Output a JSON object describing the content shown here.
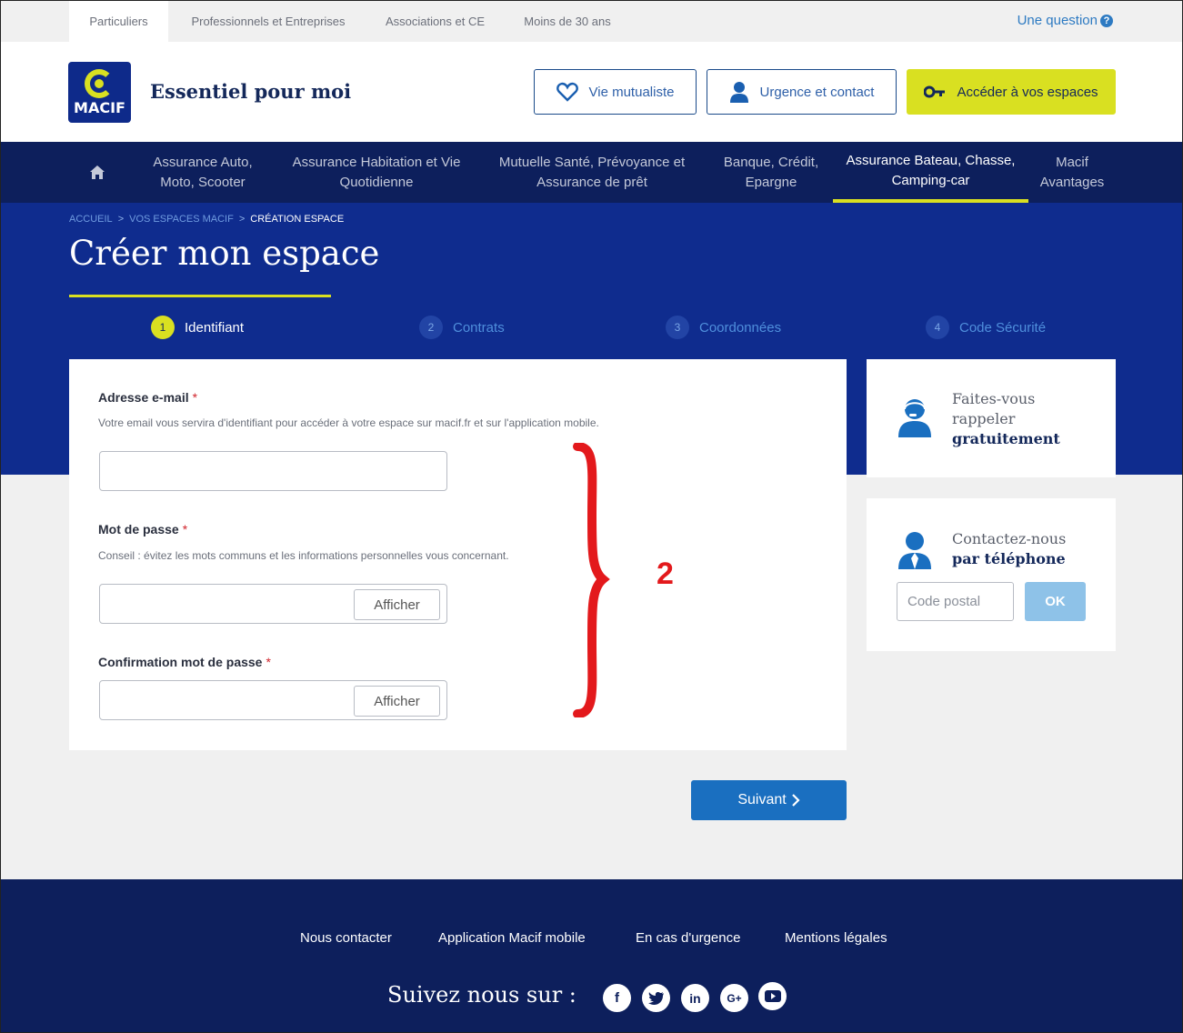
{
  "topbar": {
    "segments": [
      "Particuliers",
      "Professionnels et Entreprises",
      "Associations et CE",
      "Moins de 30 ans"
    ],
    "question": "Une question",
    "question_icon": "?"
  },
  "header": {
    "logo_text": "MACIF",
    "tagline": "Essentiel pour moi",
    "buttons": {
      "vie_mutualiste": "Vie mutualiste",
      "urgence": "Urgence et contact",
      "espaces": "Accéder à vos espaces"
    }
  },
  "nav": {
    "items": [
      "Assurance Auto, Moto, Scooter",
      "Assurance Habitation et Vie Quotidienne",
      "Mutuelle Santé, Prévoyance et Assurance de prêt",
      "Banque, Crédit, Epargne",
      "Assurance Bateau, Chasse, Camping-car",
      "Macif Avantages"
    ],
    "active_index": 4
  },
  "breadcrumb": {
    "items": [
      "ACCUEIL",
      "VOS ESPACES MACIF",
      "CRÉATION ESPACE"
    ],
    "separator": ">"
  },
  "page_title": "Créer mon espace",
  "steps": [
    {
      "num": "1",
      "label": "Identifiant",
      "active": true
    },
    {
      "num": "2",
      "label": "Contrats",
      "active": false
    },
    {
      "num": "3",
      "label": "Coordonnées",
      "active": false
    },
    {
      "num": "4",
      "label": "Code Sécurité",
      "active": false
    }
  ],
  "form": {
    "email": {
      "label": "Adresse e-mail",
      "required": "*",
      "help": "Votre email vous servira d'identifiant pour accéder à votre espace sur macif.fr et sur l'application mobile.",
      "value": ""
    },
    "password": {
      "label": "Mot de passe",
      "required": "*",
      "help": "Conseil : évitez les mots communs et les informations personnelles vous concernant.",
      "show_label": "Afficher",
      "value": ""
    },
    "confirm": {
      "label": "Confirmation mot de passe",
      "required": "*",
      "show_label": "Afficher",
      "value": ""
    },
    "annotation": "2"
  },
  "sidebar": {
    "callback": {
      "line1": "Faites-vous",
      "line2": "rappeler",
      "line3": "gratuitement"
    },
    "phone": {
      "line1": "Contactez-nous",
      "line2": "par téléphone",
      "zip_placeholder": "Code postal",
      "ok": "OK"
    }
  },
  "next_button": "Suivant",
  "footer": {
    "links": [
      "Nous contacter",
      "Application Macif mobile",
      "En cas d'urgence",
      "Mentions légales"
    ],
    "follow": "Suivez nous sur :",
    "social": [
      "facebook-icon",
      "twitter-icon",
      "linkedin-icon",
      "googleplus-icon",
      "youtube-icon"
    ]
  },
  "colors": {
    "navy": "#0d1f5c",
    "hero_blue": "#0f2c8e",
    "lime": "#d9e021",
    "primary_blue": "#1a6fc0",
    "annotation_red": "#e3191c"
  }
}
